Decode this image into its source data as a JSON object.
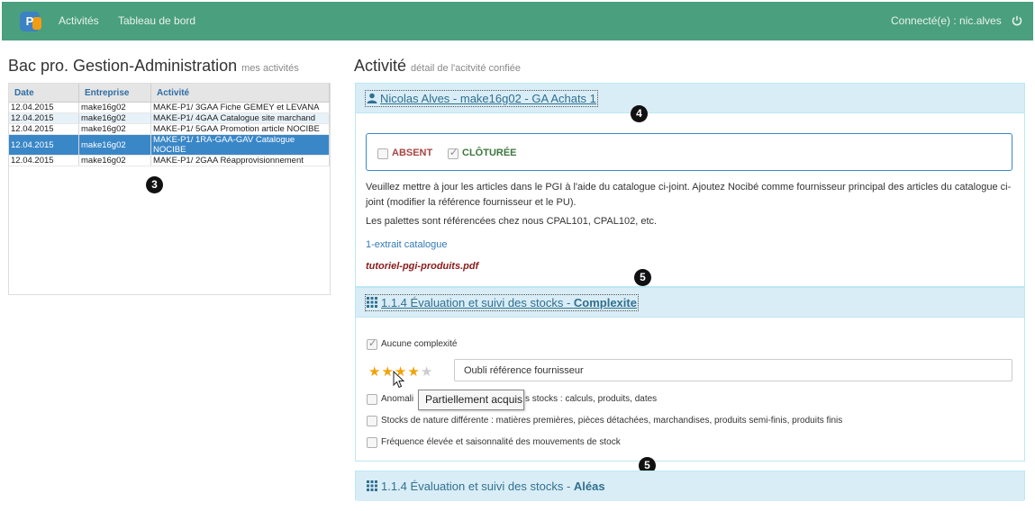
{
  "nav": {
    "items": [
      "Activités",
      "Tableau de bord"
    ],
    "user_label": "Connecté(e) : nic.alves"
  },
  "left": {
    "title": "Bac pro. Gestion-Administration",
    "subtitle": "mes activités",
    "columns": [
      "Date",
      "Entreprise",
      "Activité"
    ],
    "rows": [
      {
        "date": "12.04.2015",
        "entreprise": "make16g02",
        "activite": "MAKE-P1/ 3GAA Fiche GEMEY et LEVANA"
      },
      {
        "date": "12.04.2015",
        "entreprise": "make16g02",
        "activite": "MAKE-P1/ 4GAA Catalogue site marchand"
      },
      {
        "date": "12.04.2015",
        "entreprise": "make16g02",
        "activite": "MAKE-P1/ 5GAA Promotion article NOCIBE"
      },
      {
        "date": "12.04.2015",
        "entreprise": "make16g02",
        "activite": "MAKE-P1/ 1RA-GAA-GAV Catalogue NOCIBE"
      },
      {
        "date": "12.04.2015",
        "entreprise": "make16g02",
        "activite": "MAKE-P1/ 2GAA Réapprovisionnement"
      }
    ]
  },
  "callouts": [
    "3",
    "4",
    "5",
    "5"
  ],
  "right": {
    "title": "Activité",
    "subtitle": "détail de l'acitvité confiée",
    "panel1": {
      "heading": "Nicolas Alves - make16g02 - GA Achats 1",
      "status_absent": "ABSENT",
      "status_cloture": "CLÔTURÉE",
      "description": "Veuillez mettre à jour les articles dans le PGI à l'aide du catalogue ci-joint. Ajoutez Nocibé comme fournisseur principal des articles du catalogue ci-joint (modifier la référence fournisseur et le PU).",
      "note": "Les palettes sont référencées chez nous CPAL101, CPAL102, etc.",
      "link_extrait": "1-extrait catalogue",
      "link_pdf": "tutoriel-pgi-produits.pdf"
    },
    "panel2": {
      "heading_prefix": "1.1.4 Évaluation et suivi des stocks - ",
      "heading_strong": "Complexite",
      "aucune": "Aucune complexité",
      "rating": 4,
      "rating_max": 5,
      "comment": "Oubli référence fournisseur",
      "tooltip": "Partiellement acquis",
      "item1_start": "Anomali",
      "item1_end": "s stocks : calculs, produits, dates",
      "item2": "Stocks de nature différente : matières premières, pièces détachées, marchandises, produits semi-finis, produits finis",
      "item3": "Fréquence élevée et saisonnalité des mouvements de stock"
    },
    "panel3": {
      "heading_prefix": "1.1.4 Évaluation et suivi des stocks - ",
      "heading_strong": "Aléas"
    }
  }
}
